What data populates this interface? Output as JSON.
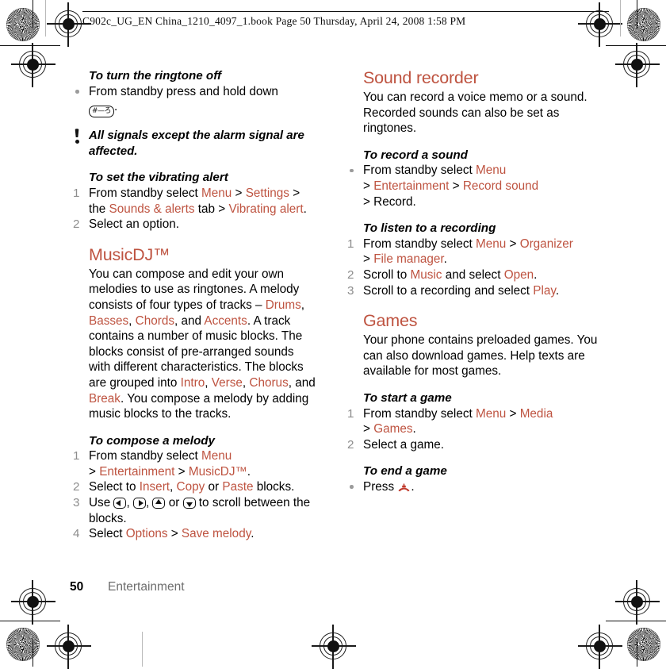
{
  "header": {
    "line": "C902c_UG_EN China_1210_4097_1.book  Page 50  Thursday, April 24, 2008  1:58 PM"
  },
  "footer": {
    "page_number": "50",
    "section": "Entertainment"
  },
  "accent_color": "#BE5340",
  "left_column": {
    "h_ringtone_off": "To turn the ringtone off",
    "ringtone_off_step_pre": "From standby press and hold down",
    "ringtone_off_key": "#—ろ",
    "ringtone_off_step_post": ".",
    "note_text": "All signals except the alarm signal are affected.",
    "h_vibrating": "To set the vibrating alert",
    "vib_1_a": "From standby select ",
    "vib_1_menu": "Menu",
    "vib_1_b": " > ",
    "vib_1_settings": "Settings",
    "vib_1_c": " > the ",
    "vib_1_sounds": "Sounds & alerts",
    "vib_1_d": " tab > ",
    "vib_1_vibrating": "Vibrating alert",
    "vib_1_e": ".",
    "vib_2": "Select an option.",
    "h_musicdj": "MusicDJ™",
    "musicdj_p_a": "You can compose and edit your own melodies to use as ringtones. A melody consists of four types of tracks – ",
    "musicdj_drums": "Drums",
    "musicdj_p_b": ", ",
    "musicdj_basses": "Basses",
    "musicdj_p_c": ", ",
    "musicdj_chords": "Chords",
    "musicdj_p_d": ", and ",
    "musicdj_accents": "Accents",
    "musicdj_p_e": ". A track contains a number of music blocks. The blocks consist of pre-arranged sounds with different characteristics. The blocks are grouped into ",
    "musicdj_intro": "Intro",
    "musicdj_p_f": ", ",
    "musicdj_verse": "Verse",
    "musicdj_p_g": ", ",
    "musicdj_chorus": "Chorus",
    "musicdj_p_h": ", and ",
    "musicdj_break": "Break",
    "musicdj_p_i": ". You compose a melody by adding music blocks to the tracks.",
    "h_compose": "To compose a melody",
    "comp_1_a": "From standby select ",
    "comp_1_menu": "Menu",
    "comp_1_b": " > ",
    "comp_1_entertainment": "Entertainment",
    "comp_1_c": " > ",
    "comp_1_musicdj": "MusicDJ™",
    "comp_1_d": ".",
    "comp_2_a": "Select to ",
    "comp_2_insert": "Insert",
    "comp_2_b": ", ",
    "comp_2_copy": "Copy",
    "comp_2_c": " or ",
    "comp_2_paste": "Paste",
    "comp_2_d": " blocks.",
    "comp_3_a": "Use ",
    "comp_3_b": ", ",
    "comp_3_c": ", ",
    "comp_3_d": " or ",
    "comp_3_e": " to scroll between the blocks.",
    "comp_4_a": "Select ",
    "comp_4_options": "Options",
    "comp_4_b": " > ",
    "comp_4_save": "Save melody",
    "comp_4_c": "."
  },
  "right_column": {
    "h_sound_recorder": "Sound recorder",
    "sound_recorder_p": "You can record a voice memo or a sound. Recorded sounds can also be set as ringtones.",
    "h_record": "To record a sound",
    "rec_a": "From standby select ",
    "rec_menu": "Menu",
    "rec_b": " > ",
    "rec_entertainment": "Entertainment",
    "rec_c": " > ",
    "rec_record_sound": "Record sound",
    "rec_d": " > Record.",
    "h_listen": "To listen to a recording",
    "lis_1_a": "From standby select ",
    "lis_1_menu": "Menu",
    "lis_1_b": " > ",
    "lis_1_organizer": "Organizer",
    "lis_1_c": " > ",
    "lis_1_filemanager": "File manager",
    "lis_1_d": ".",
    "lis_2_a": "Scroll to ",
    "lis_2_music": "Music",
    "lis_2_b": " and select ",
    "lis_2_open": "Open",
    "lis_2_c": ".",
    "lis_3_a": "Scroll to a recording and select ",
    "lis_3_play": "Play",
    "lis_3_b": ".",
    "h_games": "Games",
    "games_p": "Your phone contains preloaded games. You can also download games. Help texts are available for most games.",
    "h_start_game": "To start a game",
    "sg_1_a": "From standby select ",
    "sg_1_menu": "Menu",
    "sg_1_b": " > ",
    "sg_1_media": "Media",
    "sg_1_c": " > ",
    "sg_1_games": "Games",
    "sg_1_d": ".",
    "sg_2": "Select a game.",
    "h_end_game": "To end a game",
    "eg_a": "Press ",
    "eg_b": "."
  },
  "steps": {
    "n1": "1",
    "n2": "2",
    "n3": "3",
    "n4": "4"
  }
}
